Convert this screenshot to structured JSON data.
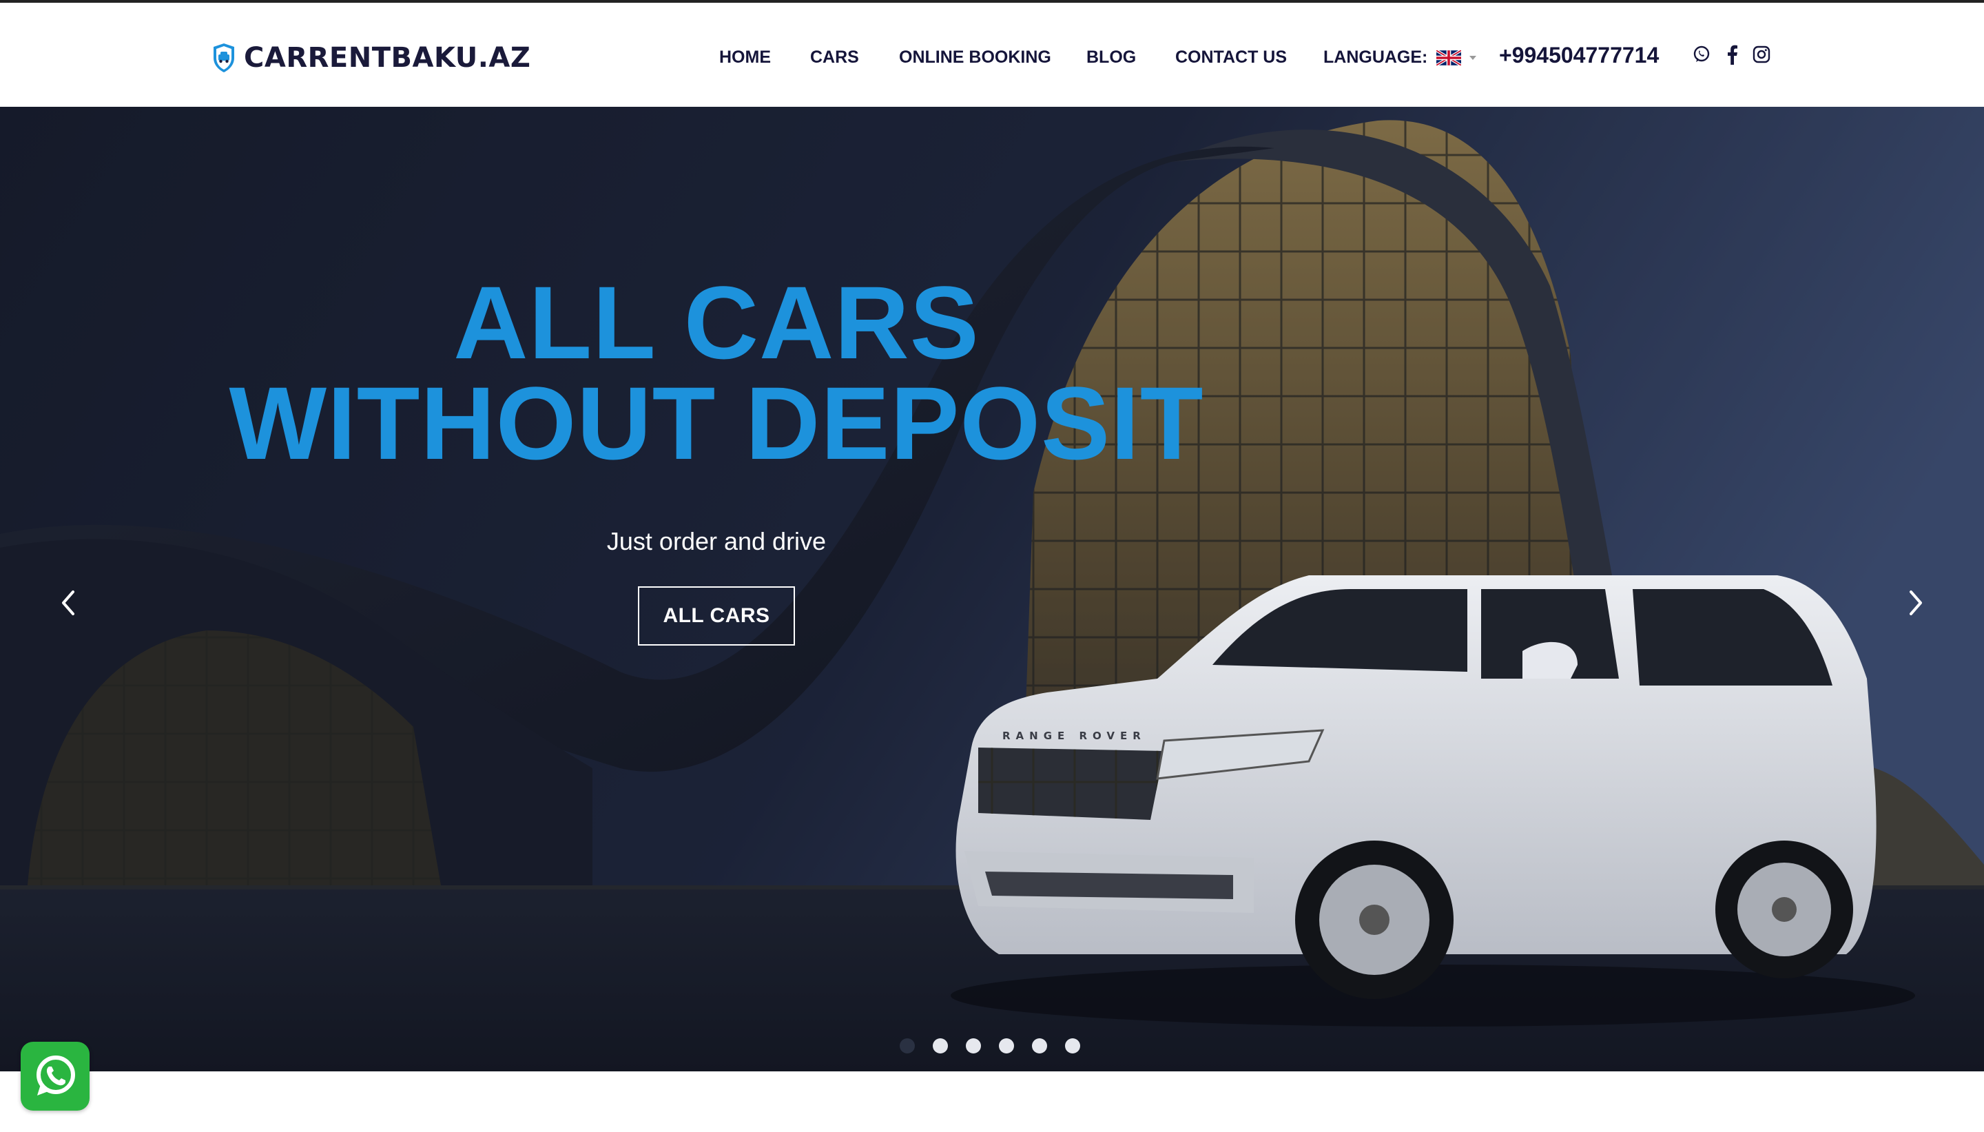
{
  "brand": {
    "name": "CARRENTBAKU.AZ",
    "logo_icon": "shield-car-icon",
    "accent": "#1d92dc"
  },
  "nav": {
    "items": [
      {
        "label": "HOME"
      },
      {
        "label": "CARS"
      },
      {
        "label": "ONLINE BOOKING"
      },
      {
        "label": "BLOG"
      },
      {
        "label": "CONTACT US"
      }
    ],
    "language_label": "LANGUAGE:",
    "language_flag": "uk-flag-icon"
  },
  "contact": {
    "phone": "+994504777714"
  },
  "social": [
    "whatsapp-icon",
    "facebook-icon",
    "instagram-icon"
  ],
  "hero": {
    "title_line1": "ALL CARS",
    "title_line2": "WITHOUT DEPOSIT",
    "subtitle": "Just order and drive",
    "button_label": "ALL CARS",
    "car_badge": "RANGE ROVER",
    "slides_total": 6,
    "active_slide": 1
  },
  "floating": {
    "icon": "whatsapp-icon",
    "color": "#2ab540"
  }
}
